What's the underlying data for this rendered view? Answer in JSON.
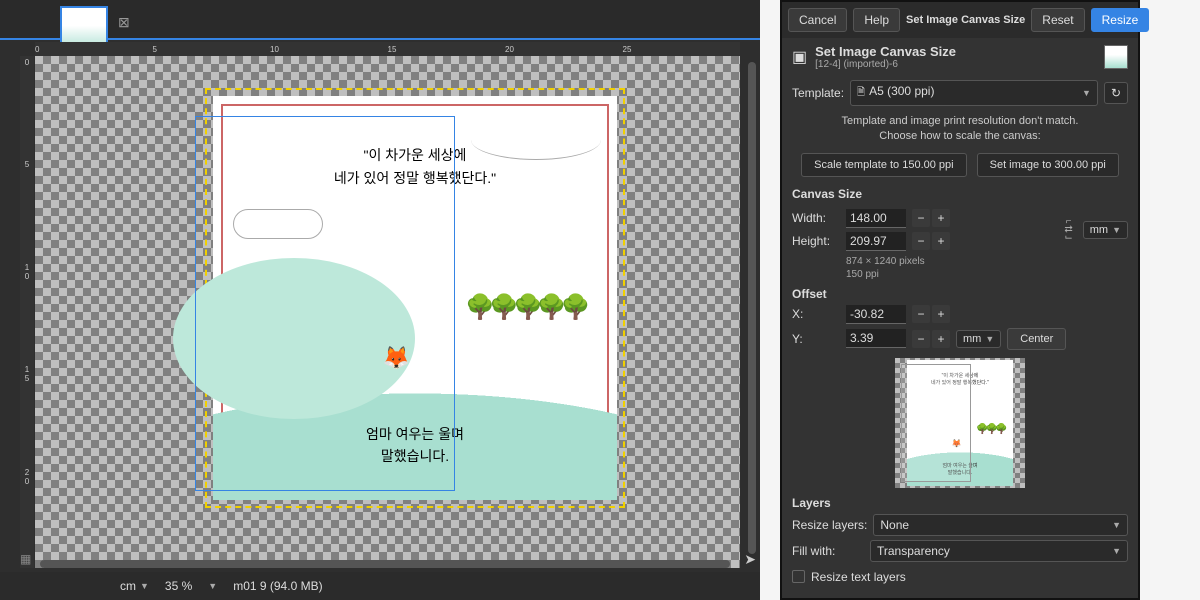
{
  "canvas": {
    "ruler_h": [
      "0",
      "5",
      "10",
      "15",
      "20",
      "25"
    ],
    "ruler_v": [
      "0",
      "5",
      "1\n0",
      "1\n5",
      "2\n0"
    ],
    "illustration": {
      "quote1": "\"이 차가운 세상에\n네가 있어 정말 행복했단다.\"",
      "quote2": "엄마 여우는 울며\n말했습니다."
    },
    "status": {
      "unit": "cm",
      "zoom": "35 %",
      "file": "m01 9 (94.0 MB)"
    }
  },
  "dialog": {
    "buttons": {
      "cancel": "Cancel",
      "help": "Help",
      "title": "Set Image Canvas Size",
      "reset": "Reset",
      "resize": "Resize"
    },
    "header": {
      "title": "Set Image Canvas Size",
      "subtitle": "[12-4] (imported)-6"
    },
    "template": {
      "label": "Template:",
      "value": "A5 (300 ppi)",
      "info": "Template and image print resolution don't match.\nChoose how to scale the canvas:",
      "scale_template_btn": "Scale template to 150.00 ppi",
      "set_image_btn": "Set image to 300.00 ppi"
    },
    "canvas_size": {
      "title": "Canvas Size",
      "width_label": "Width:",
      "width_value": "148.00",
      "height_label": "Height:",
      "height_value": "209.97",
      "unit": "mm",
      "pixels": "874 × 1240 pixels",
      "ppi": "150 ppi"
    },
    "offset": {
      "title": "Offset",
      "x_label": "X:",
      "x_value": "-30.82",
      "y_label": "Y:",
      "y_value": "3.39",
      "unit": "mm",
      "center": "Center"
    },
    "layers": {
      "title": "Layers",
      "resize_label": "Resize layers:",
      "resize_value": "None",
      "fill_label": "Fill with:",
      "fill_value": "Transparency",
      "resize_text": "Resize text layers"
    }
  }
}
